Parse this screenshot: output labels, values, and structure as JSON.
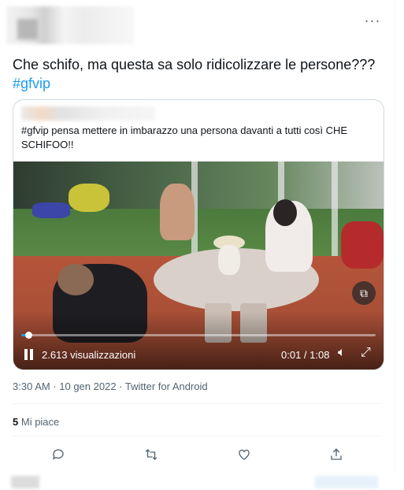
{
  "tweet": {
    "text": "Che schifo, ma questa sa solo ridicolizzare le persone???",
    "hashtag": "#gfvip",
    "meta": "3:30 AM · 10 gen 2022 · Twitter for Android",
    "likes_count": "5",
    "likes_label": "Mi piace",
    "more_icon": "more-horizontal-icon"
  },
  "quote": {
    "text": "#gfvip pensa mettere in imbarazzo una persona davanti a tutti così CHE SCHIFOO!!"
  },
  "video": {
    "views": "2.613 visualizzazioni",
    "time": "0:01 / 1:08",
    "progress_fraction": 0.015,
    "accent": "#1d9bf0"
  },
  "actions": [
    {
      "name": "reply-button",
      "icon": "reply-icon"
    },
    {
      "name": "retweet-button",
      "icon": "retweet-icon"
    },
    {
      "name": "like-button",
      "icon": "heart-icon"
    },
    {
      "name": "share-button",
      "icon": "share-icon"
    }
  ],
  "colors": {
    "text": "#0f1419",
    "secondary": "#536471",
    "link": "#1d9bf0",
    "border": "#cfd9de"
  }
}
